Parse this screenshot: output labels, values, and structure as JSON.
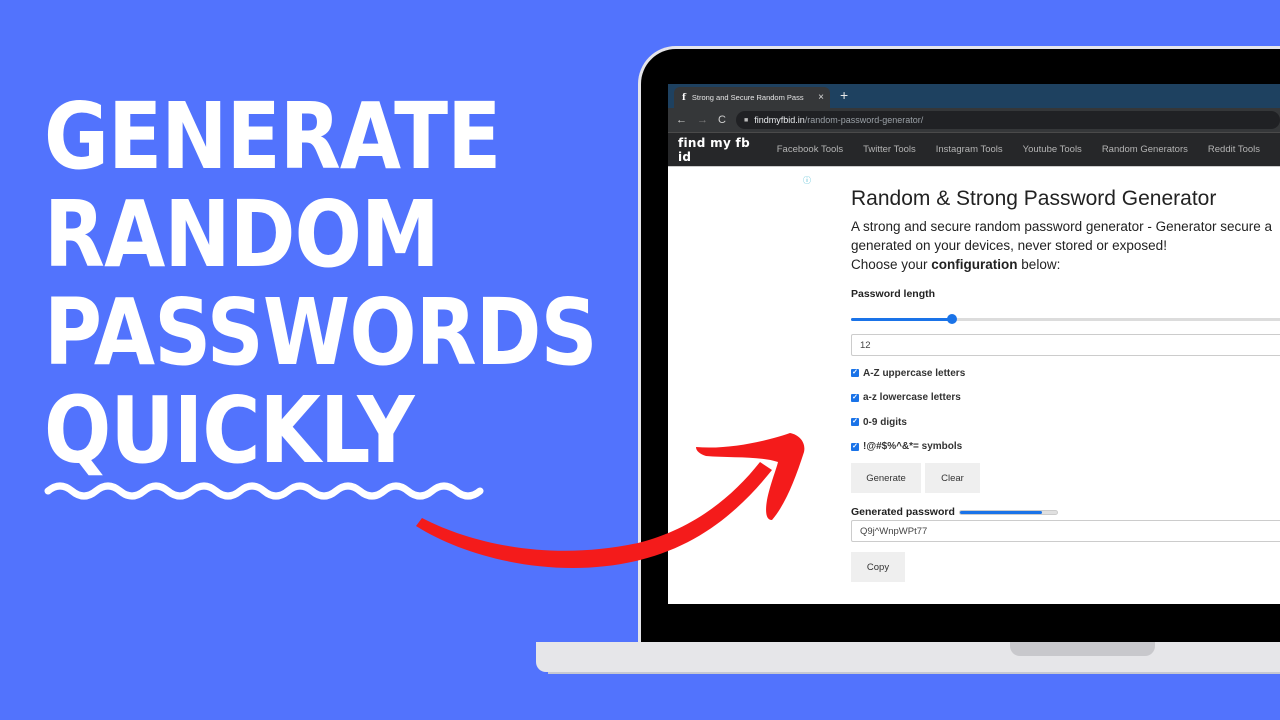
{
  "headline": {
    "lines": [
      "GENERATE",
      "RANDOM",
      "PASSWORDS",
      "QUICKLY"
    ]
  },
  "colors": {
    "background": "#5273fd",
    "arrow": "#f41b1b",
    "accent": "#1a73e8",
    "site_nav_bg": "#262729",
    "tab_bar_bg": "#1e4160"
  },
  "browser": {
    "tab_title": "Strong and Secure Random Pass",
    "tab_favicon": "f",
    "new_tab": "+",
    "close_tab": "×",
    "back": "←",
    "forward": "→",
    "reload": "C",
    "lock": "🔒",
    "url_domain": "findmyfbid.in",
    "url_path": "/random-password-generator/"
  },
  "site_nav": {
    "logo": "find my fb id",
    "links": [
      "Facebook Tools",
      "Twitter Tools",
      "Instagram Tools",
      "Youtube Tools",
      "Random Generators",
      "Reddit Tools"
    ]
  },
  "page": {
    "ad_info_icon": "ⓘ",
    "title": "Random & Strong Password Generator",
    "desc_line1": "A strong and secure random password generator - Generator secure a",
    "desc_line2": "generated on your devices, never stored or exposed!",
    "desc_line3_prefix": "Choose your ",
    "desc_line3_bold": "configuration",
    "desc_line3_suffix": " below:",
    "length_label": "Password length",
    "length_slider_fraction": 0.23,
    "length_value": "12",
    "options": [
      {
        "label": "A-Z uppercase letters",
        "checked": true
      },
      {
        "label": "a-z lowercase letters",
        "checked": true
      },
      {
        "label": "0-9 digits",
        "checked": true
      },
      {
        "label": "!@#$%^&*= symbols",
        "checked": true
      }
    ],
    "generate_label": "Generate",
    "clear_label": "Clear",
    "generated_label": "Generated password",
    "strength_fraction": 0.85,
    "generated_value": "Q9j^WnpWPt77",
    "copy_label": "Copy"
  }
}
